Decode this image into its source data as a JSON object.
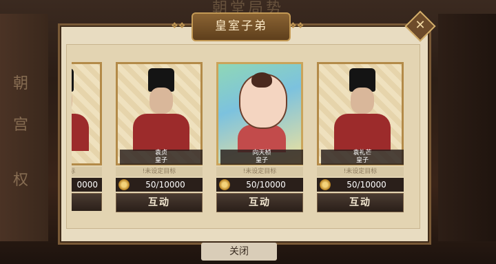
{
  "background": {
    "title": "朝堂局势"
  },
  "left_menu": {
    "items": [
      "朝",
      "宫",
      "权"
    ]
  },
  "dialog": {
    "title": "皇室子弟",
    "close_icon": "close-diamond-icon",
    "goal_text": "!未设定目标",
    "cards": [
      {
        "name": "",
        "title": "",
        "progress": "0000",
        "action": "互动",
        "partial": true
      },
      {
        "name": "袁贞",
        "title": "皇子",
        "progress": "50/10000",
        "action": "互动",
        "portrait": "adult-prince"
      },
      {
        "name": "向天桢",
        "title": "皇子",
        "progress": "50/10000",
        "action": "互动",
        "portrait": "child-prince",
        "selected": true
      },
      {
        "name": "袁礼芒",
        "title": "皇子",
        "progress": "50/10000",
        "action": "互动",
        "portrait": "adult-prince"
      }
    ]
  },
  "footer": {
    "close_label": "关闭"
  }
}
